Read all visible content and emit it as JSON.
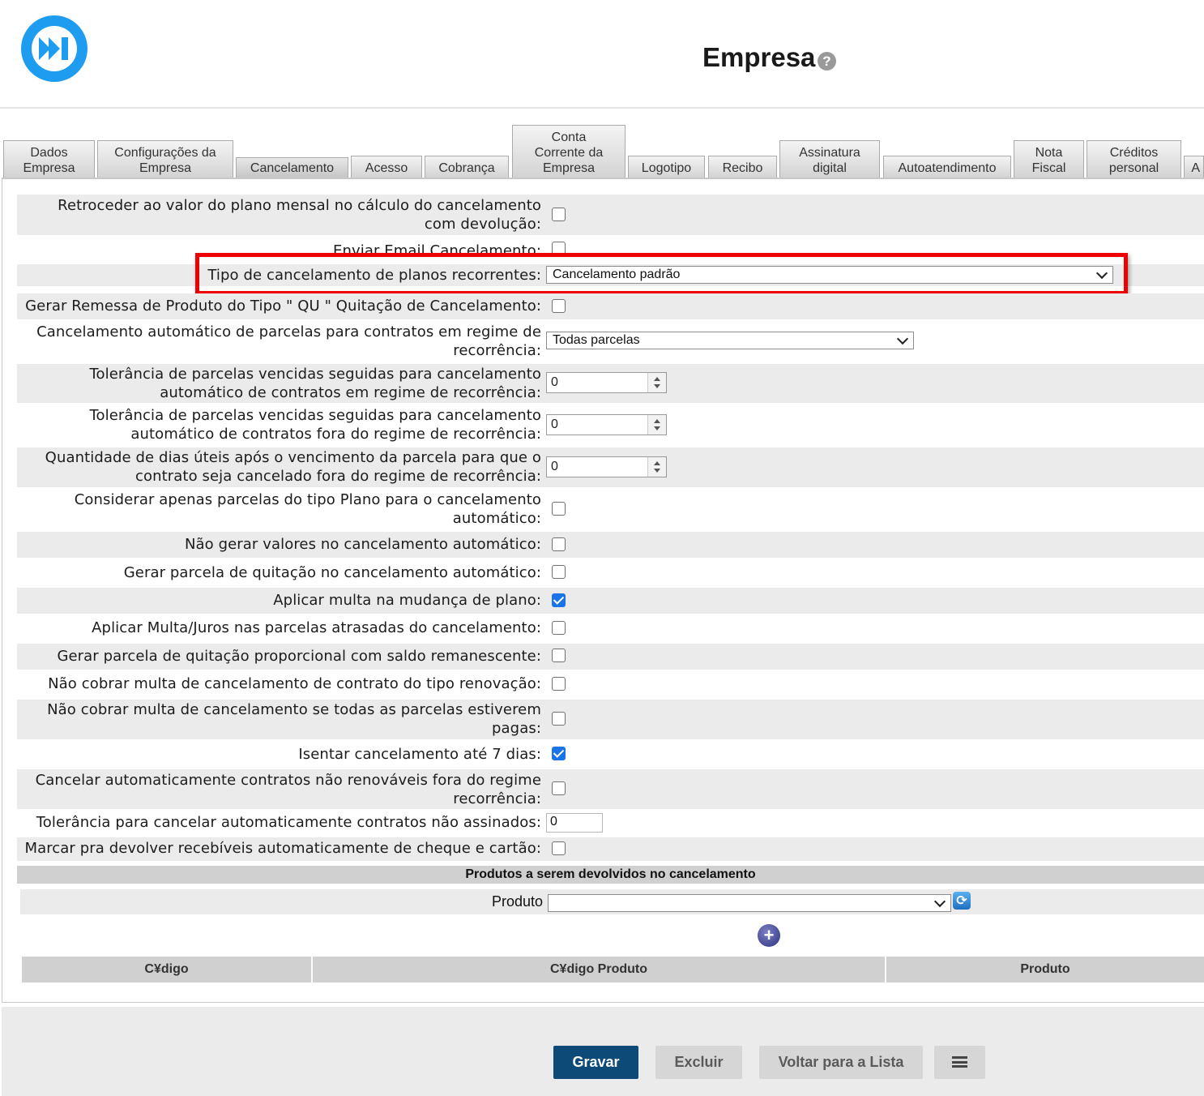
{
  "header": {
    "title": "Empresa",
    "help_glyph": "?",
    "logo_icon": "fast-forward-icon",
    "brand_color": "#1e9cf0"
  },
  "tabs": [
    {
      "label_line1": "Dados",
      "label_line2": "Empresa"
    },
    {
      "label_line1": "Configurações da",
      "label_line2": "Empresa"
    },
    {
      "label_line1": "",
      "label_line2": "Cancelamento",
      "active": true
    },
    {
      "label_line1": "",
      "label_line2": "Acesso"
    },
    {
      "label_line1": "",
      "label_line2": "Cobrança"
    },
    {
      "label_line1": "Conta",
      "label_line2": "Corrente da",
      "label_line3": "Empresa"
    },
    {
      "label_line1": "",
      "label_line2": "Logotipo"
    },
    {
      "label_line1": "",
      "label_line2": "Recibo"
    },
    {
      "label_line1": "Assinatura",
      "label_line2": "digital"
    },
    {
      "label_line1": "",
      "label_line2": "Autoatendimento"
    },
    {
      "label_line1": "Nota",
      "label_line2": "Fiscal"
    },
    {
      "label_line1": "Créditos",
      "label_line2": "personal"
    },
    {
      "label_line1": "",
      "label_line2": "A"
    }
  ],
  "form": {
    "retroceder": {
      "label": "Retroceder ao valor do plano mensal no cálculo do cancelamento com devolução:",
      "checked": false
    },
    "enviar_email": {
      "label": "Enviar Email Cancelamento:",
      "checked": false
    },
    "tipo_cancelamento": {
      "label": "Tipo de cancelamento de planos recorrentes:",
      "value": "Cancelamento padrão"
    },
    "gerar_remessa": {
      "label": "Gerar Remessa de Produto do Tipo \" QU \" Quitação de Cancelamento:",
      "checked": false
    },
    "cancelamento_automatico": {
      "label": "Cancelamento automático de parcelas para contratos em regime de recorrência:",
      "value": "Todas parcelas"
    },
    "tolerancia_recorrencia": {
      "label": "Tolerância de parcelas vencidas seguidas para cancelamento automático de contratos em regime de recorrência:",
      "value": "0"
    },
    "tolerancia_fora": {
      "label": "Tolerância de parcelas vencidas seguidas para cancelamento automático de contratos fora do regime de recorrência:",
      "value": "0"
    },
    "quantidade_dias": {
      "label": "Quantidade de dias úteis após o vencimento da parcela para que o contrato seja cancelado fora do regime de recorrência:",
      "value": "0"
    },
    "considerar_plano": {
      "label": "Considerar apenas parcelas do tipo Plano para o cancelamento automático:",
      "checked": false
    },
    "nao_gerar_valores": {
      "label": "Não gerar valores no cancelamento automático:",
      "checked": false
    },
    "gerar_quitacao": {
      "label": "Gerar parcela de quitação no cancelamento automático:",
      "checked": false
    },
    "aplicar_multa": {
      "label": "Aplicar multa na mudança de plano:",
      "checked": true
    },
    "aplicar_multa_juros": {
      "label": "Aplicar Multa/Juros nas parcelas atrasadas do cancelamento:",
      "checked": false
    },
    "quitacao_proporcional": {
      "label": "Gerar parcela de quitação proporcional com saldo remanescente:",
      "checked": false
    },
    "nao_cobrar_renovacao": {
      "label": "Não cobrar multa de cancelamento de contrato do tipo renovação:",
      "checked": false
    },
    "nao_cobrar_pagas": {
      "label": "Não cobrar multa de cancelamento se todas as parcelas estiverem pagas:",
      "checked": false
    },
    "isentar_7_dias": {
      "label": "Isentar cancelamento até 7 dias:",
      "checked": true
    },
    "cancelar_nao_renovaveis": {
      "label": "Cancelar automaticamente contratos não renováveis fora do regime recorrência:",
      "checked": false
    },
    "tolerancia_nao_assinados": {
      "label": "Tolerância para cancelar automaticamente contratos não assinados:",
      "value": "0"
    },
    "devolver_recebiveis": {
      "label": "Marcar pra devolver recebíveis automaticamente de cheque e cartão:",
      "checked": false
    }
  },
  "produtos": {
    "section_title": "Produtos a serem devolvidos no cancelamento",
    "produto_label": "Produto",
    "produto_value": "",
    "add_glyph": "+",
    "refresh_glyph": "⟳",
    "columns": [
      "C¥digo",
      "C¥digo Produto",
      "Produto"
    ]
  },
  "footer": {
    "save_label": "Gravar",
    "delete_label": "Excluir",
    "back_label": "Voltar para a Lista",
    "list_icon": "list-icon"
  },
  "highlight_color": "#ee0000"
}
